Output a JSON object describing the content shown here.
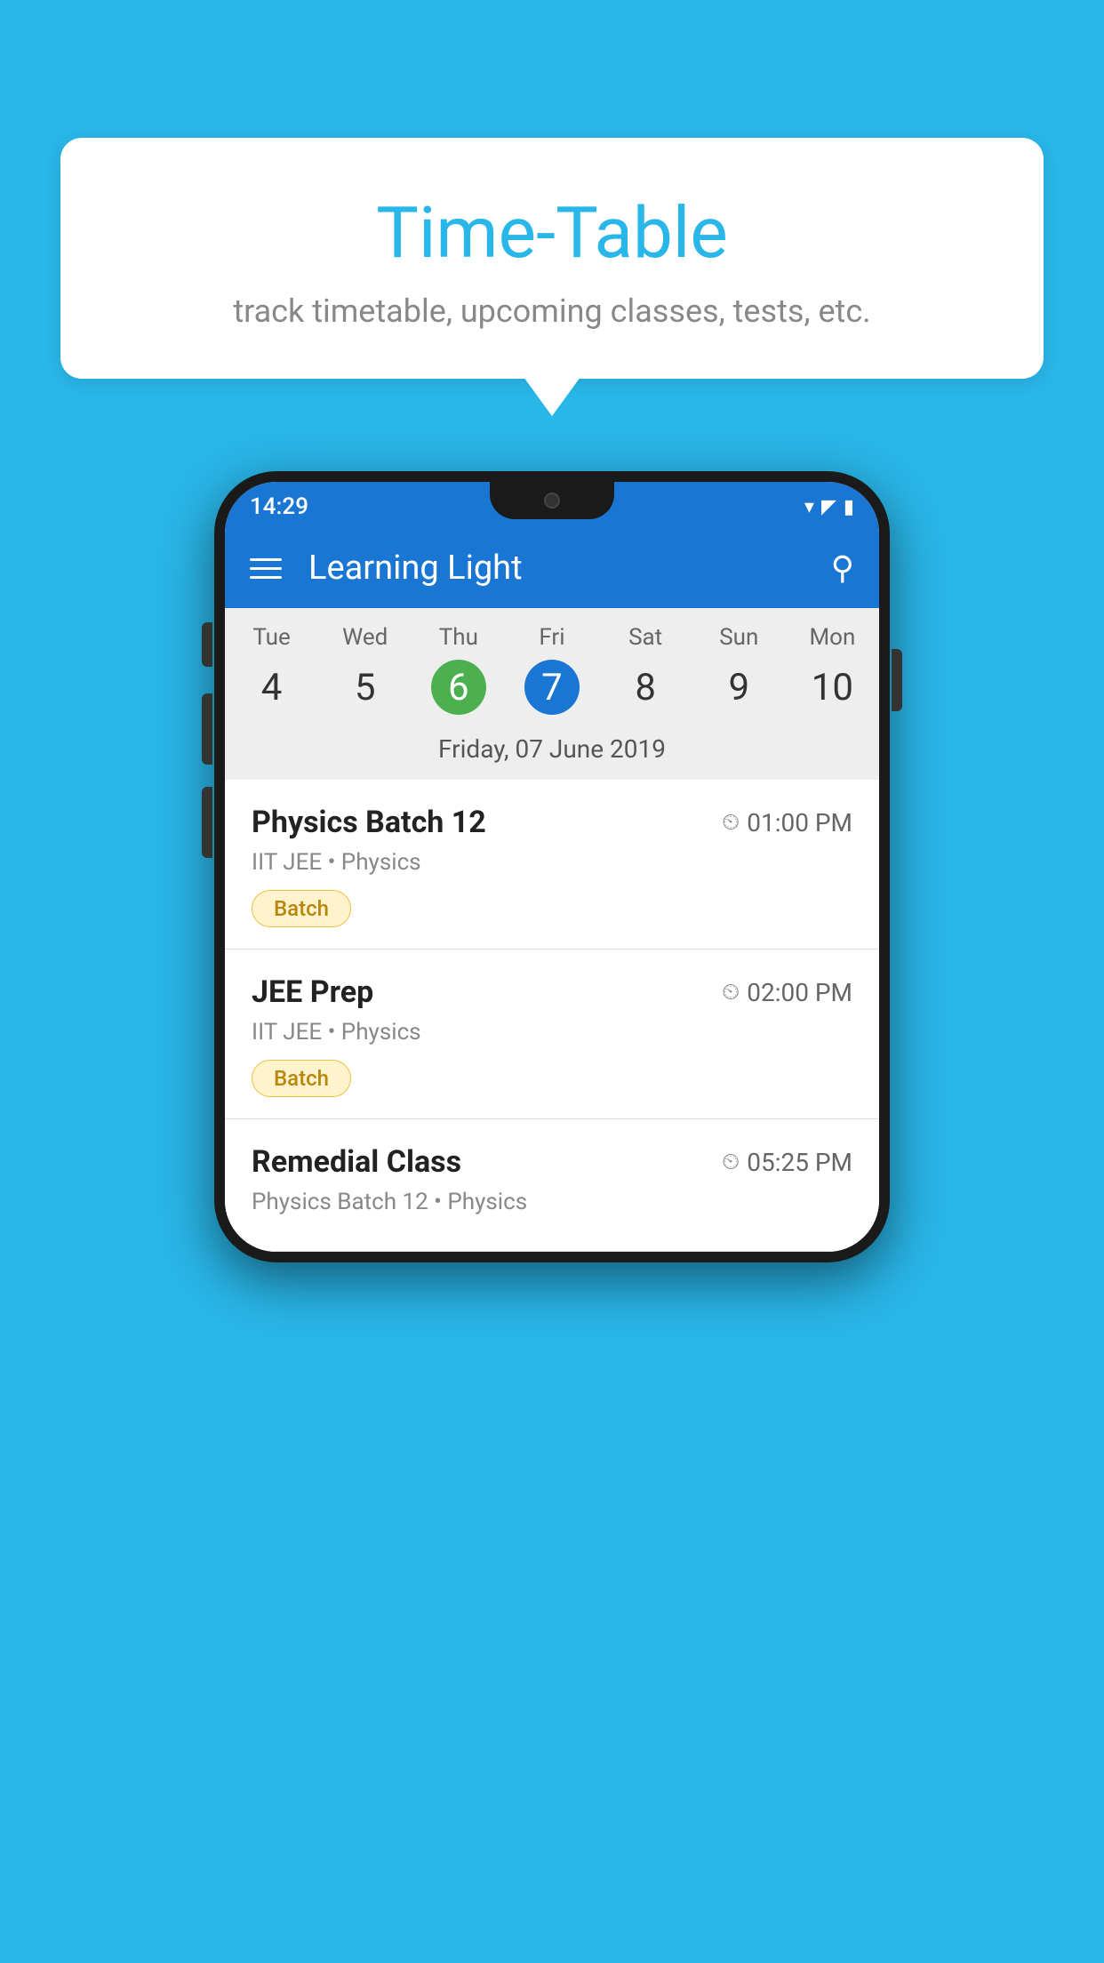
{
  "background": {
    "color": "#29B6E8"
  },
  "bubble": {
    "title": "Time-Table",
    "subtitle": "track timetable, upcoming classes, tests, etc."
  },
  "phone": {
    "status_bar": {
      "time": "14:29"
    },
    "app_bar": {
      "title": "Learning Light",
      "hamburger_label": "Menu",
      "search_label": "Search"
    },
    "calendar": {
      "days": [
        {
          "name": "Tue",
          "num": "4",
          "state": "normal"
        },
        {
          "name": "Wed",
          "num": "5",
          "state": "normal"
        },
        {
          "name": "Thu",
          "num": "6",
          "state": "today"
        },
        {
          "name": "Fri",
          "num": "7",
          "state": "selected"
        },
        {
          "name": "Sat",
          "num": "8",
          "state": "normal"
        },
        {
          "name": "Sun",
          "num": "9",
          "state": "normal"
        },
        {
          "name": "Mon",
          "num": "10",
          "state": "normal"
        }
      ],
      "date_label": "Friday, 07 June 2019"
    },
    "schedule": [
      {
        "title": "Physics Batch 12",
        "time": "01:00 PM",
        "subtitle": "IIT JEE • Physics",
        "tag": "Batch"
      },
      {
        "title": "JEE Prep",
        "time": "02:00 PM",
        "subtitle": "IIT JEE • Physics",
        "tag": "Batch"
      },
      {
        "title": "Remedial Class",
        "time": "05:25 PM",
        "subtitle": "Physics Batch 12 • Physics",
        "tag": ""
      }
    ]
  }
}
